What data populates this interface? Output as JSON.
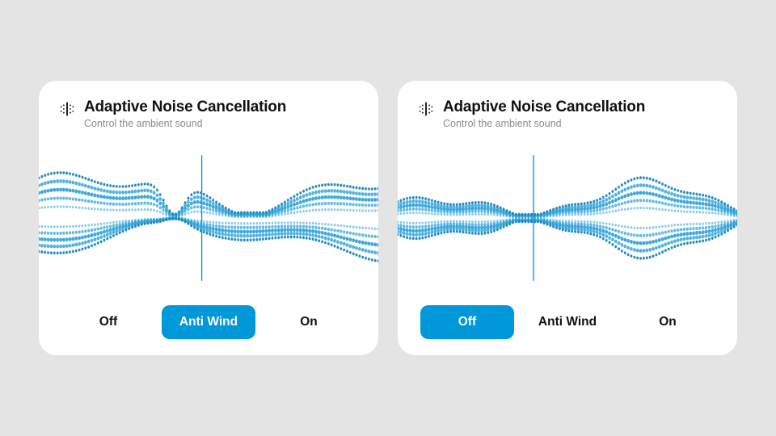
{
  "colors": {
    "accent": "#0098d8",
    "wave": "#2aa0d8",
    "waveDark": "#1c7fb3",
    "bg": "#e4e4e4",
    "card": "#ffffff",
    "text": "#111111",
    "muted": "#8c8c8c"
  },
  "cards": [
    {
      "title": "Adaptive Noise Cancellation",
      "subtitle": "Control the ambient sound",
      "selected": "antiwind",
      "wave_variant": "dual",
      "options": [
        {
          "key": "off",
          "label": "Off"
        },
        {
          "key": "antiwind",
          "label": "Anti Wind"
        },
        {
          "key": "on",
          "label": "On"
        }
      ]
    },
    {
      "title": "Adaptive Noise Cancellation",
      "subtitle": "Control the ambient sound",
      "selected": "off",
      "wave_variant": "single",
      "options": [
        {
          "key": "off",
          "label": "Off"
        },
        {
          "key": "antiwind",
          "label": "Anti Wind"
        },
        {
          "key": "on",
          "label": "On"
        }
      ]
    }
  ]
}
